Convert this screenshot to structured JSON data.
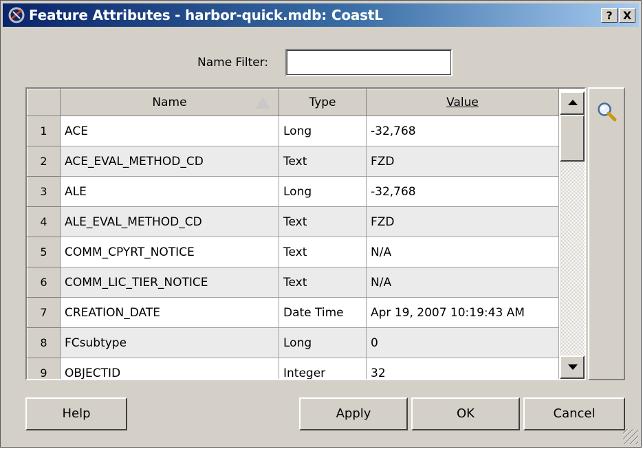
{
  "window": {
    "title": "Feature Attributes - harbor-quick.mdb: CoastL",
    "help_button": "?",
    "close_button": "X"
  },
  "filter": {
    "label": "Name Filter:",
    "value": ""
  },
  "grid": {
    "columns": [
      "Name",
      "Type",
      "Value"
    ],
    "sort_column": "Name",
    "rows": [
      {
        "num": "1",
        "name": "ACE",
        "type": "Long",
        "value": "-32,768"
      },
      {
        "num": "2",
        "name": "ACE_EVAL_METHOD_CD",
        "type": "Text",
        "value": "FZD"
      },
      {
        "num": "3",
        "name": "ALE",
        "type": "Long",
        "value": "-32,768"
      },
      {
        "num": "4",
        "name": "ALE_EVAL_METHOD_CD",
        "type": "Text",
        "value": "FZD"
      },
      {
        "num": "5",
        "name": "COMM_CPYRT_NOTICE",
        "type": "Text",
        "value": "N/A"
      },
      {
        "num": "6",
        "name": "COMM_LIC_TIER_NOTICE",
        "type": "Text",
        "value": "N/A"
      },
      {
        "num": "7",
        "name": "CREATION_DATE",
        "type": "Date Time",
        "value": "Apr 19, 2007 10:19:43 AM"
      },
      {
        "num": "8",
        "name": "FCsubtype",
        "type": "Long",
        "value": "0"
      },
      {
        "num": "9",
        "name": "OBJECTID",
        "type": "Integer",
        "value": "32"
      }
    ]
  },
  "icons": {
    "app": "app-icon",
    "zoom": "magnifier-icon"
  },
  "buttons": {
    "help": "Help",
    "apply": "Apply",
    "ok": "OK",
    "cancel": "Cancel"
  },
  "colors": {
    "titlebar_start": "#0a246a",
    "titlebar_end": "#a6caf0",
    "dialog_bg": "#d4d0c8"
  }
}
